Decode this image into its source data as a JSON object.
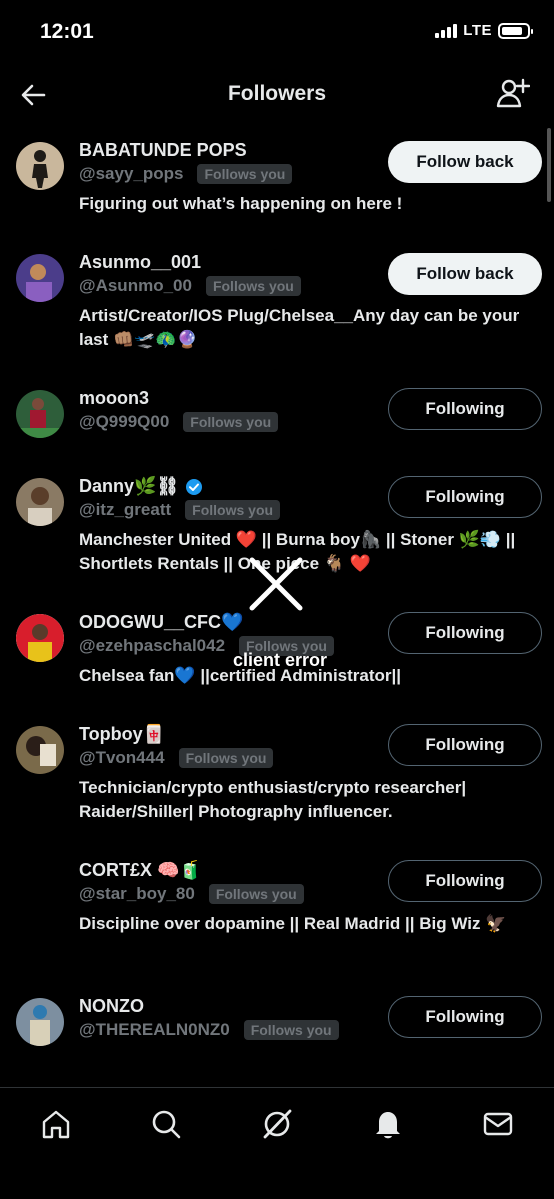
{
  "status": {
    "time": "12:01",
    "network": "LTE",
    "battery_level": 0.85
  },
  "header": {
    "title": "Followers",
    "back_icon": "arrow-left-icon",
    "add_icon": "add-user-icon"
  },
  "followers": [
    {
      "name": "BABATUNDE POPS",
      "handle": "@sayy_pops",
      "follows_you": "Follows you",
      "bio": "Figuring out what’s happening on here !",
      "button": "Follow back",
      "avatar_color": "#c9b79c"
    },
    {
      "name": "Asunmo__001",
      "handle": "@Asunmo_00",
      "follows_you": "Follows you",
      "bio": "Artist/Creator/IOS Plug/Chelsea__Any day can be your last 👊🏽🛫🦚🔮",
      "button": "Follow back",
      "avatar_color": "#4b3d8a"
    },
    {
      "name": "mooon3",
      "handle": "@Q999Q00",
      "follows_you": "Follows you",
      "bio": "",
      "button": "Following",
      "avatar_color": "#2e5e3a"
    },
    {
      "name": "Danny🌿⛓",
      "handle": "@itz_greatt",
      "follows_you": "Follows you",
      "bio": "Manchester United ❤️ || Burna boy🦍 || Stoner 🌿💨 || Shortlets Rentals || One piece 🐐 ❤️",
      "button": "Following",
      "avatar_color": "#8a7a64",
      "verified": true
    },
    {
      "name": "ODOGWU__CFC💙",
      "handle": "@ezehpaschal042",
      "follows_you": "Follows you",
      "bio": "Chelsea fan💙 ||certified Administrator||",
      "button": "Following",
      "avatar_color": "#d4b21a"
    },
    {
      "name": "Topboy🀄",
      "handle": "@Tvon444",
      "follows_you": "Follows you",
      "bio": "Technician/crypto enthusiast/crypto researcher| Raider/Shiller| Photography influencer.",
      "button": "Following",
      "avatar_color": "#7a6a4a"
    },
    {
      "name": "CORT£X 🧠🧃",
      "handle": "@star_boy_80",
      "follows_you": "Follows you",
      "bio": "Discipline over dopamine || Real Madrid || Big Wiz 🦅",
      "button": "Following",
      "avatar_color": "#000000"
    },
    {
      "name": "NONZO",
      "handle": "@THEREALN0NZ0",
      "follows_you": "Follows you",
      "bio": "",
      "button": "Following",
      "avatar_color": "#7d8fa0"
    }
  ],
  "error": {
    "message": "client error"
  },
  "tabs": [
    {
      "name": "home-icon"
    },
    {
      "name": "search-icon"
    },
    {
      "name": "grok-icon"
    },
    {
      "name": "notifications-icon"
    },
    {
      "name": "messages-icon"
    }
  ]
}
